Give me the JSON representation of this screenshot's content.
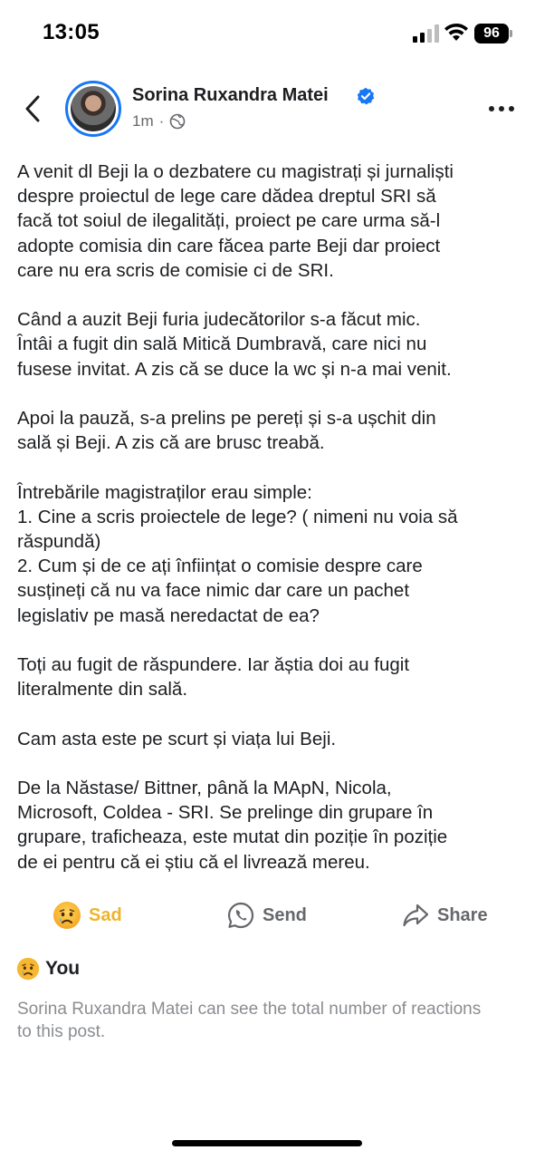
{
  "status_bar": {
    "time": "13:05",
    "battery": "96"
  },
  "post": {
    "author": "Sorina Ruxandra Matei",
    "timestamp": "1m",
    "separator": "·",
    "privacy_icon": "globe-icon",
    "verified_icon": "verified-badge-icon",
    "paragraphs": [
      [
        "A venit dl Beji la o dezbatere cu magistrați și jurnaliști",
        "despre proiectul de lege care dădea dreptul SRI să",
        "facă tot soiul de ilegalități, proiect pe care urma să-l",
        "adopte comisia din care făcea parte Beji dar proiect",
        "care nu era scris de comisie ci de SRI."
      ],
      [
        "Când a auzit Beji furia judecătorilor s-a făcut mic.",
        "Întâi a fugit din sală Mitică Dumbravă, care nici nu",
        "fusese invitat. A zis că se duce la wc și n-a mai venit."
      ],
      [
        "Apoi la pauză, s-a prelins pe pereți și s-a ușchit din",
        "sală și Beji. A zis că are brusc treabă."
      ],
      [
        "Întrebările magistraților erau simple:",
        "1. Cine a scris proiectele de lege? ( nimeni nu voia să",
        "răspundă)",
        "2. Cum și de ce ați înființat o comisie despre care",
        "susțineți că nu va face nimic dar care un pachet",
        "legislativ pe masă neredactat de ea?"
      ],
      [
        "Toți au fugit de răspundere. Iar ăștia doi au fugit",
        "literalmente din sală."
      ],
      [
        "Cam asta este pe scurt și viața lui Beji."
      ],
      [
        "De la Năstase/ Bittner, până la MApN, Nicola,",
        "Microsoft, Coldea - SRI. Se prelinge din grupare în",
        "grupare, traficheaza, este mutat din poziție în poziție",
        "de ei pentru că ei știu că el livrează mereu."
      ]
    ]
  },
  "actions": {
    "sad_label": "Sad",
    "send_label": "Send",
    "share_label": "Share"
  },
  "reactions": {
    "you_label": "You",
    "note": "Sorina Ruxandra Matei can see the total number of reactions to this post."
  },
  "colors": {
    "accent_blue": "#1877f2",
    "sad_yellow": "#f0b429",
    "muted_text": "#65676b"
  }
}
